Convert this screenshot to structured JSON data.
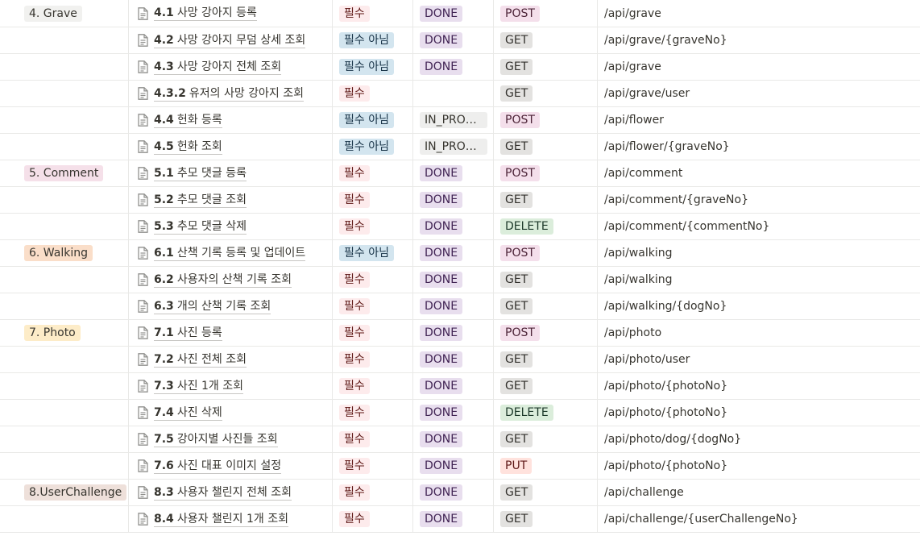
{
  "colors": {
    "req_required_bg": "#fdebec",
    "req_required_fg": "#5d1715",
    "req_optional_bg": "#d3e5ef",
    "req_optional_fg": "#183347",
    "status_done_bg": "#e8deee",
    "status_done_fg": "#412454",
    "status_progress_bg": "#eeeeed",
    "status_progress_fg": "#37352f",
    "method_post_bg": "#f4dfeb",
    "method_post_fg": "#4c2337",
    "method_get_bg": "#e3e2e0",
    "method_get_fg": "#32302c",
    "method_delete_bg": "#dbeddb",
    "method_delete_fg": "#1c3829",
    "method_put_bg": "#ffe2dd",
    "method_put_fg": "#5d1715",
    "cat_grave_bg": "#f1f1ef",
    "cat_comment_bg": "#f5e0e9",
    "cat_walking_bg": "#fadec9",
    "cat_photo_bg": "#fdecc8",
    "cat_userchallenge_bg": "#eee0da"
  },
  "icons": {
    "page": "document-icon"
  },
  "rows": [
    {
      "category": "4. Grave",
      "cat_color": "#f1f1ef",
      "num": "4.1",
      "title": "사망 강아지 등록",
      "req": "필수",
      "req_type": "required",
      "status": "DONE",
      "status_type": "done",
      "method": "POST",
      "url": "/api/grave"
    },
    {
      "category": "",
      "cat_color": "",
      "num": "4.2",
      "title": "사망 강아지 무덤 상세 조회",
      "req": "필수 아님",
      "req_type": "optional",
      "status": "DONE",
      "status_type": "done",
      "method": "GET",
      "url": "/api/grave/{graveNo}"
    },
    {
      "category": "",
      "cat_color": "",
      "num": "4.3",
      "title": "사망 강아지 전체 조회",
      "req": "필수 아님",
      "req_type": "optional",
      "status": "DONE",
      "status_type": "done",
      "method": "GET",
      "url": "/api/grave"
    },
    {
      "category": "",
      "cat_color": "",
      "num": "4.3.2",
      "title": "유저의 사망 강아지 조회",
      "req": "필수",
      "req_type": "required",
      "status": "",
      "status_type": "",
      "method": "GET",
      "url": "/api/grave/user"
    },
    {
      "category": "",
      "cat_color": "",
      "num": "4.4",
      "title": "헌화 등록",
      "req": "필수 아님",
      "req_type": "optional",
      "status": "IN_PROG...",
      "status_type": "progress",
      "method": "POST",
      "url": "/api/flower"
    },
    {
      "category": "",
      "cat_color": "",
      "num": "4.5",
      "title": "헌화 조회",
      "req": "필수 아님",
      "req_type": "optional",
      "status": "IN_PROG...",
      "status_type": "progress",
      "method": "GET",
      "url": "/api/flower/{graveNo}"
    },
    {
      "category": "5. Comment",
      "cat_color": "#f5e0e9",
      "num": "5.1",
      "title": "추모 댓글 등록",
      "req": "필수",
      "req_type": "required",
      "status": "DONE",
      "status_type": "done",
      "method": "POST",
      "url": "/api/comment"
    },
    {
      "category": "",
      "cat_color": "",
      "num": "5.2",
      "title": "추모 댓글 조회",
      "req": "필수",
      "req_type": "required",
      "status": "DONE",
      "status_type": "done",
      "method": "GET",
      "url": "/api/comment/{graveNo}"
    },
    {
      "category": "",
      "cat_color": "",
      "num": "5.3",
      "title": "추모 댓글 삭제",
      "req": "필수",
      "req_type": "required",
      "status": "DONE",
      "status_type": "done",
      "method": "DELETE",
      "url": "/api/comment/{commentNo}"
    },
    {
      "category": "6. Walking",
      "cat_color": "#fadec9",
      "num": "6.1",
      "title": "산책 기록 등록 및 업데이트",
      "req": "필수 아님",
      "req_type": "optional",
      "status": "DONE",
      "status_type": "done",
      "method": "POST",
      "url": "/api/walking"
    },
    {
      "category": "",
      "cat_color": "",
      "num": "6.2",
      "title": "사용자의 산책 기록 조회",
      "req": "필수",
      "req_type": "required",
      "status": "DONE",
      "status_type": "done",
      "method": "GET",
      "url": "/api/walking"
    },
    {
      "category": "",
      "cat_color": "",
      "num": "6.3",
      "title": "개의 산책 기록 조회",
      "req": "필수",
      "req_type": "required",
      "status": "DONE",
      "status_type": "done",
      "method": "GET",
      "url": "/api/walking/{dogNo}"
    },
    {
      "category": "7. Photo",
      "cat_color": "#fdecc8",
      "num": "7.1",
      "title": "사진 등록",
      "req": "필수",
      "req_type": "required",
      "status": "DONE",
      "status_type": "done",
      "method": "POST",
      "url": "/api/photo"
    },
    {
      "category": "",
      "cat_color": "",
      "num": "7.2",
      "title": "사진 전체 조회",
      "req": "필수",
      "req_type": "required",
      "status": "DONE",
      "status_type": "done",
      "method": "GET",
      "url": "/api/photo/user"
    },
    {
      "category": "",
      "cat_color": "",
      "num": "7.3",
      "title": "사진 1개 조회",
      "req": "필수",
      "req_type": "required",
      "status": "DONE",
      "status_type": "done",
      "method": "GET",
      "url": "/api/photo/{photoNo}"
    },
    {
      "category": "",
      "cat_color": "",
      "num": "7.4",
      "title": "사진 삭제",
      "req": "필수",
      "req_type": "required",
      "status": "DONE",
      "status_type": "done",
      "method": "DELETE",
      "url": "/api/photo/{photoNo}"
    },
    {
      "category": "",
      "cat_color": "",
      "num": "7.5",
      "title": "강아지별 사진들 조회",
      "req": "필수",
      "req_type": "required",
      "status": "DONE",
      "status_type": "done",
      "method": "GET",
      "url": "/api/photo/dog/{dogNo}"
    },
    {
      "category": "",
      "cat_color": "",
      "num": "7.6",
      "title": "사진 대표 이미지 설정",
      "req": "필수",
      "req_type": "required",
      "status": "DONE",
      "status_type": "done",
      "method": "PUT",
      "url": "/api/photo/{photoNo}"
    },
    {
      "category": "8.UserChallenge",
      "cat_color": "#eee0da",
      "num": "8.3",
      "title": "사용자 챌린지 전체 조회",
      "req": "필수",
      "req_type": "required",
      "status": "DONE",
      "status_type": "done",
      "method": "GET",
      "url": "/api/challenge"
    },
    {
      "category": "",
      "cat_color": "",
      "num": "8.4",
      "title": "사용자 챌린지 1개 조회",
      "req": "필수",
      "req_type": "required",
      "status": "DONE",
      "status_type": "done",
      "method": "GET",
      "url": "/api/challenge/{userChallengeNo}"
    }
  ]
}
